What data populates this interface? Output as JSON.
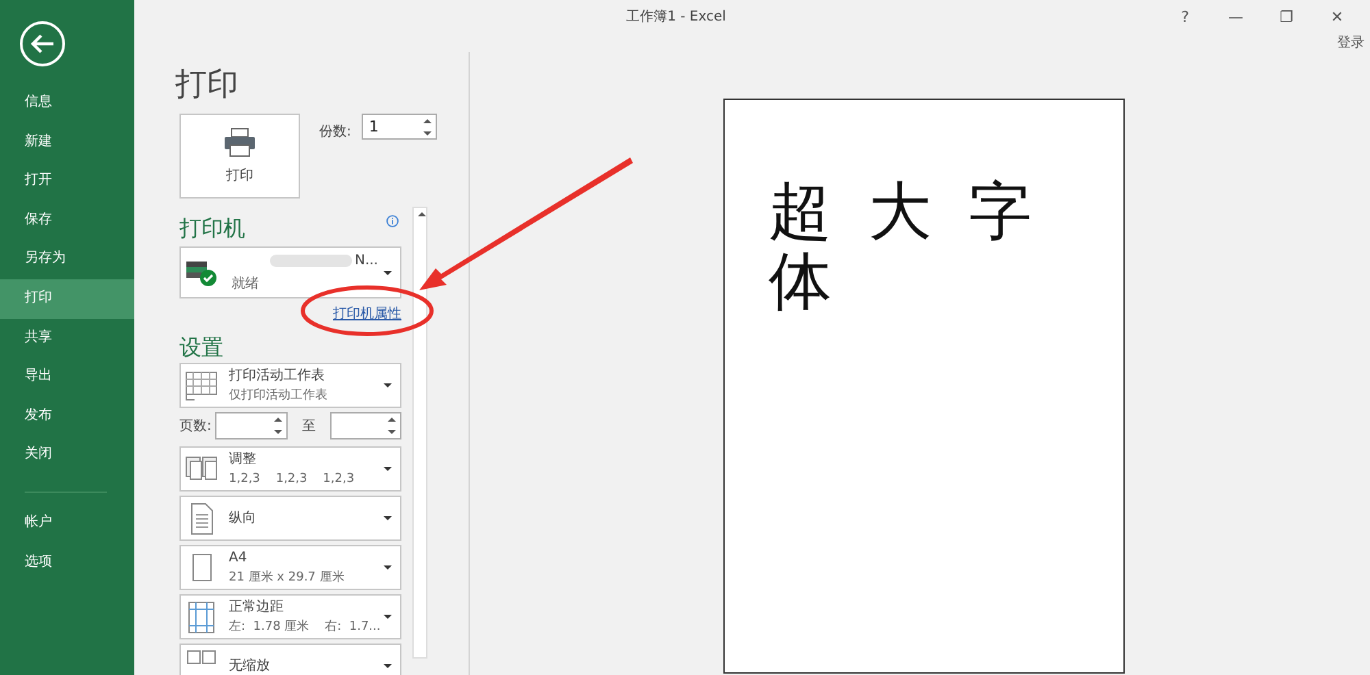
{
  "window": {
    "title": "工作簿1 - Excel",
    "controls": [
      "?",
      "—",
      "❐",
      "✕"
    ],
    "sign_in": "登录"
  },
  "sidebar": {
    "items": [
      {
        "label": "信息",
        "selected": false
      },
      {
        "label": "新建",
        "selected": false
      },
      {
        "label": "打开",
        "selected": false
      },
      {
        "label": "保存",
        "selected": false
      },
      {
        "label": "另存为",
        "selected": false
      },
      {
        "label": "打印",
        "selected": true
      },
      {
        "label": "共享",
        "selected": false
      },
      {
        "label": "导出",
        "selected": false
      },
      {
        "label": "发布",
        "selected": false
      },
      {
        "label": "关闭",
        "selected": false
      }
    ],
    "bottom_items": [
      {
        "label": "帐户",
        "selected": false
      },
      {
        "label": "选项",
        "selected": false
      }
    ]
  },
  "page_title": "打印",
  "print_button": {
    "label": "打印"
  },
  "copies": {
    "label": "份数:",
    "value": "1"
  },
  "printer": {
    "heading": "打印机",
    "name": "N...",
    "status": "就绪",
    "properties_link": "打印机属性"
  },
  "settings": {
    "heading": "设置",
    "options": [
      {
        "kind": "sheet",
        "title": "打印活动工作表",
        "subtitle": "仅打印活动工作表"
      },
      {
        "kind": "pages",
        "label": "页数:",
        "to": "至"
      },
      {
        "kind": "collate",
        "title": "调整",
        "subtitle": "1,2,3    1,2,3    1,2,3"
      },
      {
        "kind": "orientation",
        "title": "纵向"
      },
      {
        "kind": "paper",
        "title": "A4",
        "subtitle": "21 厘米 x 29.7 厘米"
      },
      {
        "kind": "margins",
        "title": "正常边距",
        "subtitle": "左:  1.78 厘米    右:  1.7..."
      },
      {
        "kind": "scaling",
        "title": "无缩放"
      }
    ]
  },
  "preview": {
    "text": "超大字体"
  }
}
